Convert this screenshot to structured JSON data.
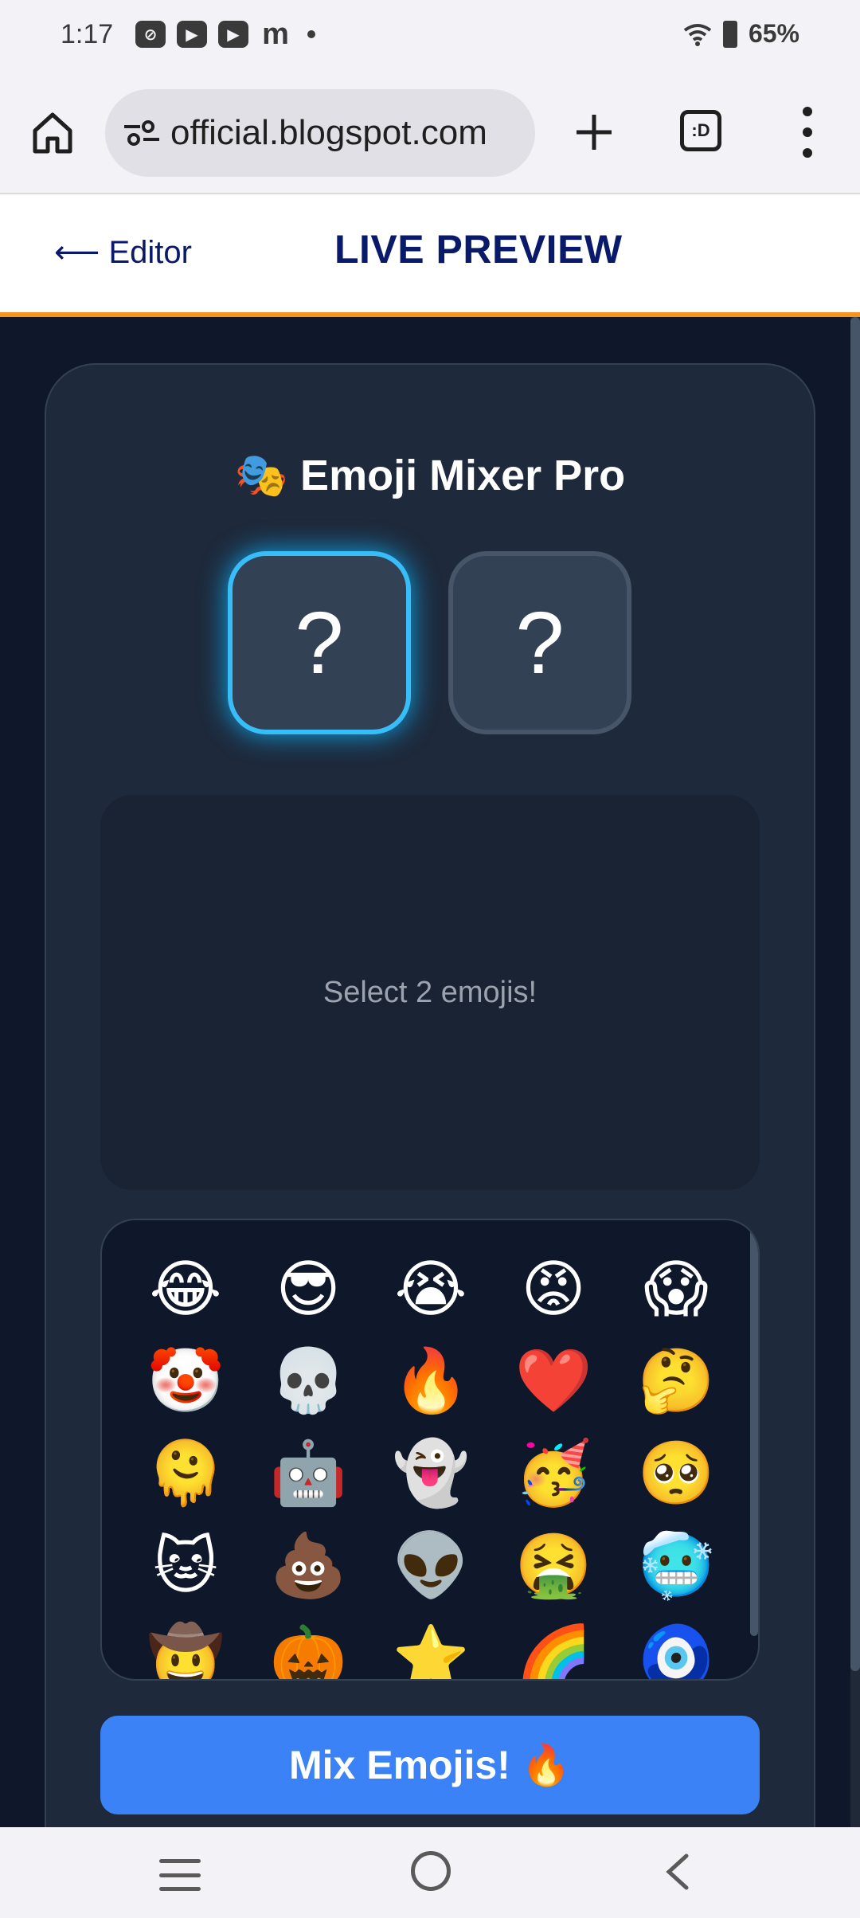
{
  "status_bar": {
    "time": "1:17",
    "battery": "65%",
    "icons": [
      "app-icon",
      "youtube-icon",
      "youtube-icon",
      "m-icon",
      "dot-icon"
    ]
  },
  "browser": {
    "url": "official.blogspot.com",
    "tabs_label": ":D"
  },
  "header": {
    "back_label": "⟵ Editor",
    "title": "LIVE PREVIEW",
    "accent_color": "#f7941d"
  },
  "app": {
    "title": "🎭 Emoji Mixer Pro",
    "slot1": "?",
    "slot2": "?",
    "result_prompt": "Select 2 emojis!",
    "emojis": [
      "😂",
      "😎",
      "😭",
      "😡",
      "😱",
      "🤡",
      "💀",
      "🔥",
      "❤️",
      "🤔",
      "🫠",
      "🤖",
      "👻",
      "🥳",
      "🥺",
      "🐱",
      "💩",
      "👽",
      "🤮",
      "🥶",
      "🤠",
      "🎃",
      "⭐",
      "🌈",
      "🧿"
    ],
    "mix_button": "Mix Emojis! 🔥",
    "accent_color": "#3b82f6",
    "highlight_color": "#38bdf8"
  }
}
